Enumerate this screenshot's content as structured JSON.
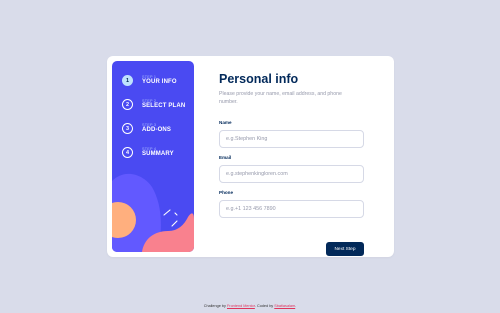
{
  "colors": {
    "page_bg": "#d9dcea",
    "sidebar_bg": "#4a4af2",
    "active_step_bg": "#bfe2fd",
    "heading": "#02295a",
    "muted": "#9699ab",
    "button_bg": "#022959",
    "link": "#e0345c"
  },
  "steps": [
    {
      "kicker": "STEP 1",
      "title": "YOUR INFO",
      "number": "1",
      "active": true
    },
    {
      "kicker": "STEP 2",
      "title": "SELECT PLAN",
      "number": "2",
      "active": false
    },
    {
      "kicker": "STEP 3",
      "title": "ADD-ONS",
      "number": "3",
      "active": false
    },
    {
      "kicker": "STEP 4",
      "title": "SUMMARY",
      "number": "4",
      "active": false
    }
  ],
  "form": {
    "title": "Personal info",
    "subtitle": "Please provide your name, email address, and phone number.",
    "fields": [
      {
        "label": "Name",
        "placeholder": "e.g.Stephen King",
        "value": ""
      },
      {
        "label": "Email",
        "placeholder": "e.g.stephenkingloren.com",
        "value": ""
      },
      {
        "label": "Phone",
        "placeholder": "e.g.+1 123 456 7890",
        "value": ""
      }
    ],
    "next_label": "Next Step"
  },
  "attribution": {
    "prefix": "Challenge by",
    "challenge_link": "Frontend Mentor",
    "middle": ". Coded by",
    "author_link": "Sbatiasalam",
    "suffix": "."
  }
}
